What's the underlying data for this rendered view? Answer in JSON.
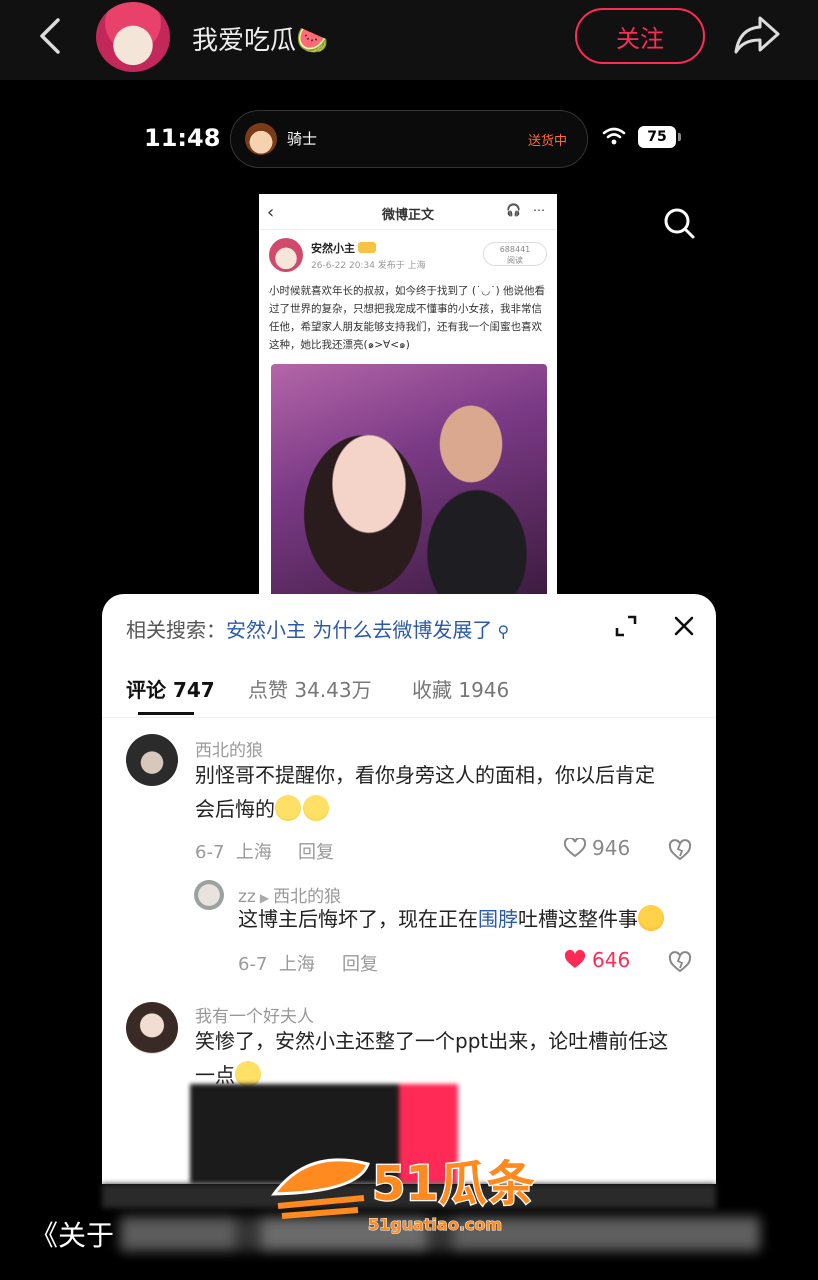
{
  "header": {
    "author_name": "我爱吃瓜🍉",
    "follow_label": "关注"
  },
  "screenshot": {
    "status_time": "11:48",
    "island_name": "骑士",
    "island_status": "送货中",
    "battery": "75",
    "weibo": {
      "back": "‹",
      "title": "微博正文",
      "icons": "🎧 ⋯",
      "user_name": "安然小主",
      "meta": "26-6-22 20:34  发布于 上海",
      "reads_count": "688441",
      "reads_label": "阅读",
      "text": "小时候就喜欢年长的叔叔，如今终于找到了 (˙◡˙) 他说他看过了世界的复杂，只想把我宠成不懂事的小女孩，我非常信任他，希望家人朋友能够支持我们，还有我一个闺蜜也喜欢这种，她比我还漂亮(๑>∀<๑)"
    }
  },
  "sheet": {
    "related_label": "相关搜索：",
    "related_query": "安然小主 为什么去微博发展了",
    "related_search_icon": "search-icon",
    "tabs": [
      {
        "label": "评论 747"
      },
      {
        "label": "点赞 34.43万"
      },
      {
        "label": "收藏 1946"
      }
    ],
    "comments": [
      {
        "name": "西北的狼",
        "text_line1": "别怪哥不提醒你，看你身旁这人的面相，你以后肯定",
        "text_line2": "会后悔的",
        "date": "6-7",
        "location": "上海",
        "reply_label": "回复",
        "likes": "946"
      },
      {
        "name": "zz",
        "reply_to": "西北的狼",
        "text_pre": "这博主后悔坏了，现在正在",
        "text_link": "围脖",
        "text_post": "吐槽这整件事",
        "date": "6-7",
        "location": "上海",
        "reply_label": "回复",
        "likes": "646"
      },
      {
        "name": "我有一个好夫人",
        "text_line1": "笑惨了，安然小主还整了一个ppt出来，论吐槽前任这",
        "text_line2": "一点"
      }
    ]
  },
  "caption": {
    "prefix": "《关于"
  },
  "watermark": {
    "brand": "51瓜条",
    "url": "51guatiao.com"
  },
  "colors": {
    "accent": "#fe2c55",
    "link": "#2a5aa8"
  }
}
